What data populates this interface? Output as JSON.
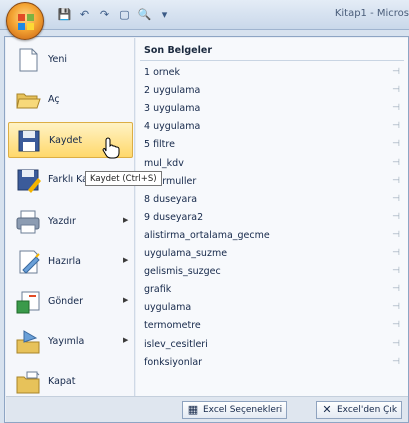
{
  "window": {
    "title": "Kitap1 - Micros"
  },
  "qat": {
    "save": "💾",
    "undo": "↶",
    "redo": "↷",
    "new": "▢",
    "preview": "🔍",
    "customize": "▾"
  },
  "commands": [
    {
      "label": "Yeni",
      "has_arrow": false,
      "icon": "new-document-icon"
    },
    {
      "label": "Aç",
      "has_arrow": false,
      "icon": "open-folder-icon"
    },
    {
      "label": "Kaydet",
      "has_arrow": false,
      "icon": "save-icon"
    },
    {
      "label": "Farklı Kay",
      "has_arrow": true,
      "icon": "save-as-icon"
    },
    {
      "label": "Yazdır",
      "has_arrow": true,
      "icon": "printer-icon"
    },
    {
      "label": "Hazırla",
      "has_arrow": true,
      "icon": "prepare-icon"
    },
    {
      "label": "Gönder",
      "has_arrow": true,
      "icon": "send-icon"
    },
    {
      "label": "Yayımla",
      "has_arrow": true,
      "icon": "publish-icon"
    },
    {
      "label": "Kapat",
      "has_arrow": false,
      "icon": "close-folder-icon"
    }
  ],
  "tooltip": "Kaydet (Ctrl+S)",
  "recent": {
    "title": "Son Belgeler",
    "pin": "⊣",
    "items": [
      "1 ornek",
      "2 uygulama",
      "3 uygulama",
      "4 uygulama",
      "5 filtre",
      "mul_kdv",
      "7 formuller",
      "8 duseyara",
      "9 duseyara2",
      "alistirma_ortalama_gecme",
      "uygulama_suzme",
      "gelismis_suzgec",
      "grafik",
      "uygulama",
      "termometre",
      "islev_cesitleri",
      "fonksiyonlar"
    ]
  },
  "footer": {
    "options_label": "Excel Seçenekleri",
    "exit_label": "Excel'den Çık"
  },
  "colors": {
    "accent": "#ffd86b",
    "frame": "#8ea5c4"
  }
}
